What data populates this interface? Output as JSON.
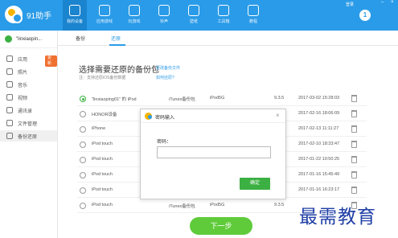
{
  "app": {
    "title": "91助手",
    "brand_color": "#2a9be8"
  },
  "top_nav": [
    {
      "label": "我的设备",
      "icon": "device-icon",
      "active": true
    },
    {
      "label": "应用游戏",
      "icon": "app-store-icon",
      "active": false
    },
    {
      "label": "玩游戏",
      "icon": "gamepad-icon",
      "active": false
    },
    {
      "label": "铃声",
      "icon": "music-note-icon",
      "active": false
    },
    {
      "label": "壁纸",
      "icon": "image-icon",
      "active": false
    },
    {
      "label": "工具箱",
      "icon": "toolbox-icon",
      "active": false
    },
    {
      "label": "教程",
      "icon": "tutorial-icon",
      "active": false
    }
  ],
  "top_right": {
    "login": "登录",
    "avatar_text": "1",
    "minimize": "–",
    "close": "×"
  },
  "sidebar": {
    "device_name": "\"linxiaopin...",
    "items": [
      {
        "label": "应用",
        "icon": "apps-icon",
        "badge": "更新"
      },
      {
        "label": "照片",
        "icon": "photo-icon",
        "badge": ""
      },
      {
        "label": "音乐",
        "icon": "music-icon",
        "badge": ""
      },
      {
        "label": "视频",
        "icon": "video-icon",
        "badge": ""
      },
      {
        "label": "通讯录",
        "icon": "contacts-icon",
        "badge": ""
      },
      {
        "label": "文件管理",
        "icon": "folder-icon",
        "badge": ""
      },
      {
        "label": "备份还原",
        "icon": "restore-icon",
        "badge": ""
      }
    ]
  },
  "tabs": [
    {
      "label": "备份",
      "active": false
    },
    {
      "label": "还原",
      "active": true
    }
  ],
  "main": {
    "heading": "选择需要还原的备份包",
    "link_1": "更改备份文件",
    "link_2": "如何还原?",
    "note": "注：支持还原iOS备份数据"
  },
  "backup_rows": [
    {
      "name": "\"linxiaoping01\" 的 iPod",
      "type": "iTunes备份包",
      "model": "iPod5G",
      "version": "9.3.5",
      "date": "2017-03-02 15:28:03",
      "selected": true
    },
    {
      "name": "HONOR设备",
      "type": "",
      "model": "",
      "version": "",
      "date": "2017-02-16 18:06:09",
      "selected": false
    },
    {
      "name": "iPhone",
      "type": "",
      "model": "",
      "version": "",
      "date": "2017-02-13 11:11:27",
      "selected": false
    },
    {
      "name": "iPod touch",
      "type": "",
      "model": "",
      "version": "",
      "date": "2017-02-10 18:33:47",
      "selected": false
    },
    {
      "name": "iPod touch",
      "type": "",
      "model": "",
      "version": "",
      "date": "2017-01-22 10:50:25",
      "selected": false
    },
    {
      "name": "iPod touch",
      "type": "",
      "model": "",
      "version": "",
      "date": "2017-01-16 15:45:49",
      "selected": false
    },
    {
      "name": "iPod touch",
      "type": "",
      "model": "",
      "version": "",
      "date": "2017-01-16 16:23:17",
      "selected": false
    },
    {
      "name": "iPod touch",
      "type": "iTunes备份包",
      "model": "iPod5G",
      "version": "9.3.5",
      "date": "",
      "selected": false
    }
  ],
  "dialog": {
    "title": "密码输入",
    "password_label": "密码：",
    "password_value": "",
    "ok_label": "确定",
    "close": "×"
  },
  "next_button": "下一步",
  "watermark": "最需教育"
}
